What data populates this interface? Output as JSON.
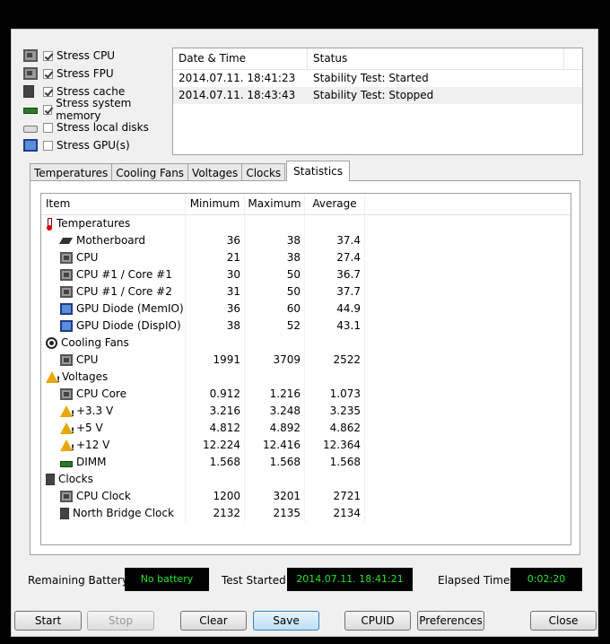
{
  "stress": [
    {
      "label": "Stress CPU",
      "checked": true,
      "icon": "cpu-chip-icon"
    },
    {
      "label": "Stress FPU",
      "checked": true,
      "icon": "fpu-icon"
    },
    {
      "label": "Stress cache",
      "checked": true,
      "icon": "cache-icon"
    },
    {
      "label": "Stress system memory",
      "checked": true,
      "icon": "memory-icon"
    },
    {
      "label": "Stress local disks",
      "checked": false,
      "icon": "hdd-icon"
    },
    {
      "label": "Stress GPU(s)",
      "checked": false,
      "icon": "gpu-icon"
    }
  ],
  "log": {
    "headers": [
      "Date & Time",
      "Status"
    ],
    "rows": [
      [
        "2014.07.11. 18:41:23",
        "Stability Test: Started"
      ],
      [
        "2014.07.11. 18:43:43",
        "Stability Test: Stopped"
      ]
    ]
  },
  "tabs": [
    "Temperatures",
    "Cooling Fans",
    "Voltages",
    "Clocks",
    "Statistics"
  ],
  "active_tab": "Statistics",
  "stats": {
    "headers": [
      "Item",
      "Minimum",
      "Maximum",
      "Average"
    ],
    "rows": [
      {
        "label": "Temperatures",
        "group": true,
        "icon": "thermometer-icon",
        "min": "",
        "max": "",
        "avg": ""
      },
      {
        "label": "Motherboard",
        "icon": "motherboard-icon",
        "min": "36",
        "max": "38",
        "avg": "37.4"
      },
      {
        "label": "CPU",
        "icon": "cpu-chip-icon",
        "min": "21",
        "max": "38",
        "avg": "27.4"
      },
      {
        "label": "CPU #1 / Core #1",
        "icon": "cpu-chip-icon",
        "min": "30",
        "max": "50",
        "avg": "36.7"
      },
      {
        "label": "CPU #1 / Core #2",
        "icon": "cpu-chip-icon",
        "min": "31",
        "max": "50",
        "avg": "37.7"
      },
      {
        "label": "GPU Diode (MemIO)",
        "icon": "gpu-icon",
        "min": "36",
        "max": "60",
        "avg": "44.9"
      },
      {
        "label": "GPU Diode (DispIO)",
        "icon": "gpu-icon",
        "min": "38",
        "max": "52",
        "avg": "43.1"
      },
      {
        "label": "Cooling Fans",
        "group": true,
        "icon": "fan-icon",
        "min": "",
        "max": "",
        "avg": ""
      },
      {
        "label": "CPU",
        "icon": "cpu-chip-icon",
        "min": "1991",
        "max": "3709",
        "avg": "2522"
      },
      {
        "label": "Voltages",
        "group": true,
        "icon": "warning-icon",
        "min": "",
        "max": "",
        "avg": ""
      },
      {
        "label": "CPU Core",
        "icon": "cpu-chip-icon",
        "min": "0.912",
        "max": "1.216",
        "avg": "1.073"
      },
      {
        "label": "+3.3 V",
        "icon": "warning-icon",
        "min": "3.216",
        "max": "3.248",
        "avg": "3.235"
      },
      {
        "label": "+5 V",
        "icon": "warning-icon",
        "min": "4.812",
        "max": "4.892",
        "avg": "4.862"
      },
      {
        "label": "+12 V",
        "icon": "warning-icon",
        "min": "12.224",
        "max": "12.416",
        "avg": "12.364"
      },
      {
        "label": "DIMM",
        "icon": "memory-icon",
        "min": "1.568",
        "max": "1.568",
        "avg": "1.568"
      },
      {
        "label": "Clocks",
        "group": true,
        "icon": "clock-icon",
        "min": "",
        "max": "",
        "avg": ""
      },
      {
        "label": "CPU Clock",
        "icon": "cpu-chip-icon",
        "min": "1200",
        "max": "3201",
        "avg": "2721"
      },
      {
        "label": "North Bridge Clock",
        "icon": "clock-icon",
        "min": "2132",
        "max": "2135",
        "avg": "2134"
      }
    ]
  },
  "status": {
    "battery_label": "Remaining Battery:",
    "battery_value": "No battery",
    "started_label": "Test Started:",
    "started_value": "2014.07.11. 18:41:21",
    "elapsed_label": "Elapsed Time:",
    "elapsed_value": "0:02:20",
    "lcd_color": "#27e627"
  },
  "buttons": {
    "start": "Start",
    "stop": "Stop",
    "clear": "Clear",
    "save": "Save",
    "cpuid": "CPUID",
    "preferences": "Preferences",
    "close": "Close"
  }
}
